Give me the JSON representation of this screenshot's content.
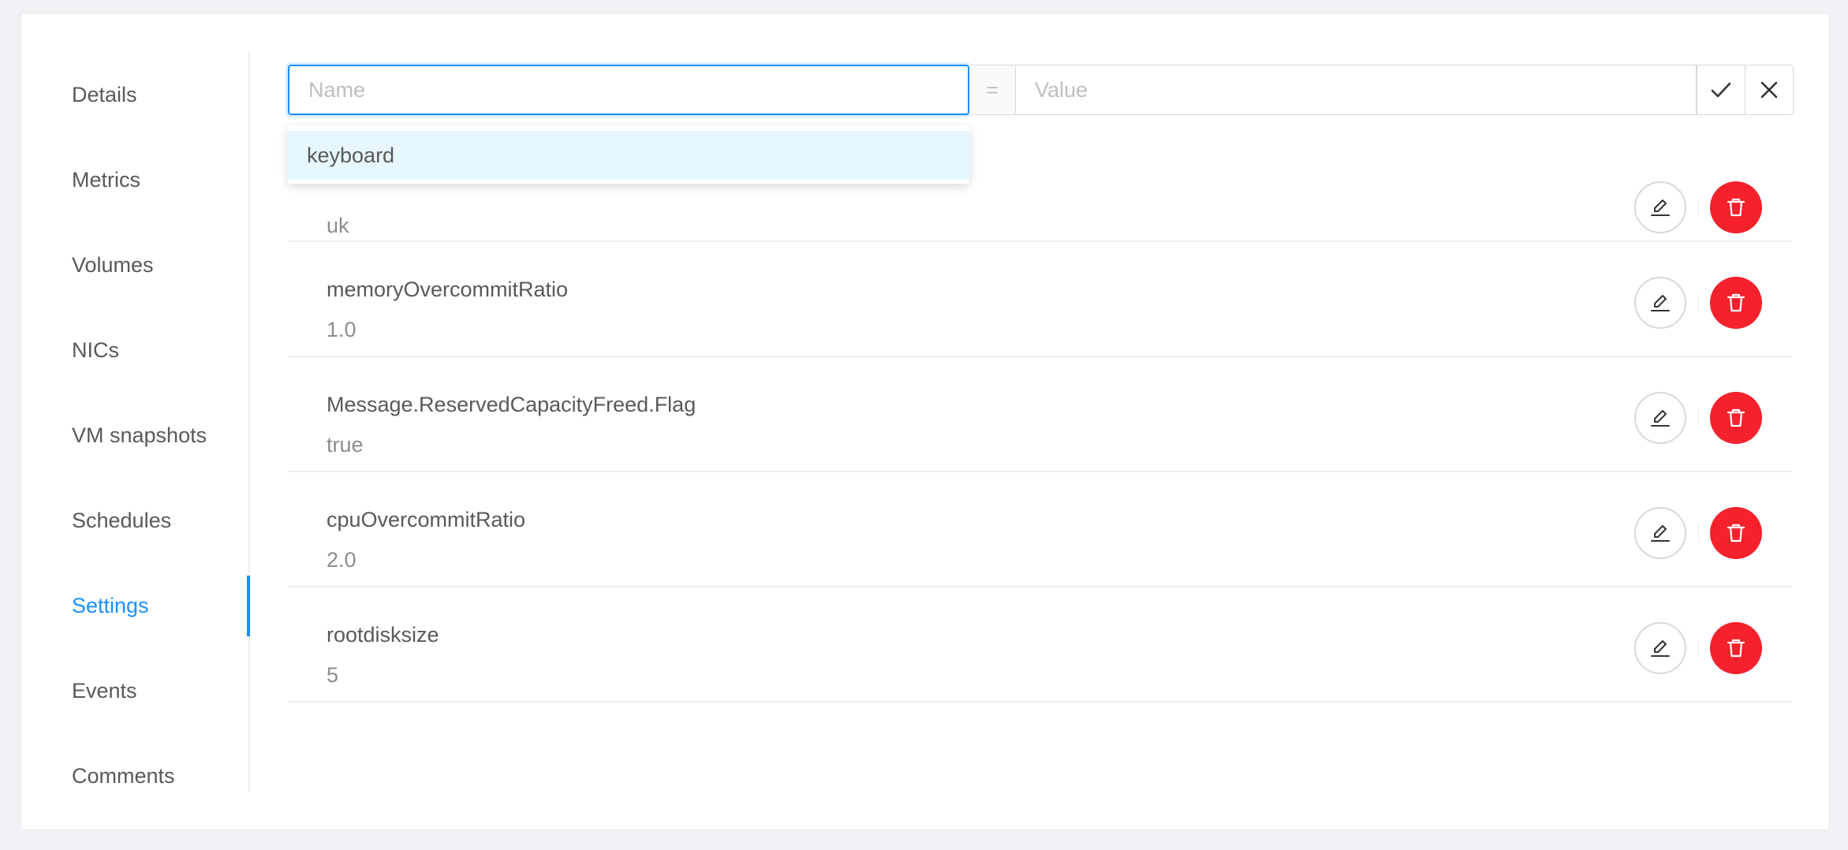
{
  "sidebar": {
    "tabs": [
      {
        "label": "Details"
      },
      {
        "label": "Metrics"
      },
      {
        "label": "Volumes"
      },
      {
        "label": "NICs"
      },
      {
        "label": "VM snapshots"
      },
      {
        "label": "Schedules"
      },
      {
        "label": "Settings",
        "active": true
      },
      {
        "label": "Events"
      },
      {
        "label": "Comments"
      }
    ]
  },
  "settings_form": {
    "name_placeholder": "Name",
    "name_value": "",
    "separator": "=",
    "value_placeholder": "Value",
    "value_value": "",
    "confirm_icon": "check-icon",
    "cancel_icon": "close-icon",
    "autocomplete_options": [
      {
        "label": "keyboard",
        "highlighted": true
      }
    ]
  },
  "settings_list": [
    {
      "key": "keyboard",
      "value": "uk"
    },
    {
      "key": "memoryOvercommitRatio",
      "value": "1.0"
    },
    {
      "key": "Message.ReservedCapacityFreed.Flag",
      "value": "true"
    },
    {
      "key": "cpuOvercommitRatio",
      "value": "2.0"
    },
    {
      "key": "rootdisksize",
      "value": "5"
    }
  ],
  "row_actions": {
    "edit_icon": "edit-icon",
    "delete_icon": "delete-icon"
  },
  "colors": {
    "accent": "#1890ff",
    "danger": "#f5222d",
    "background": "#f0f2f5",
    "highlight": "#e6f7ff"
  }
}
